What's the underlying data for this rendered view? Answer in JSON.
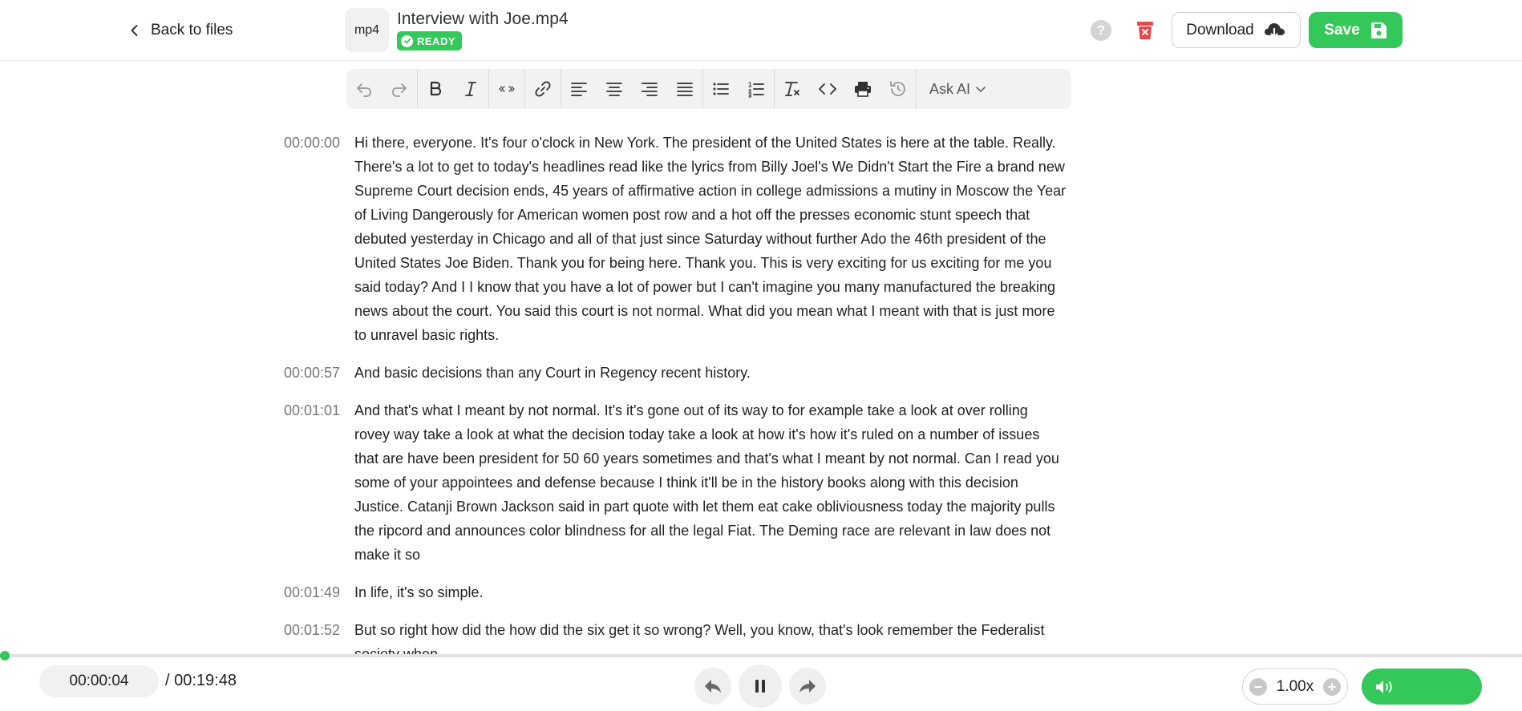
{
  "header": {
    "back_label": "Back to files",
    "file_type": "mp4",
    "file_title": "Interview with Joe.mp4",
    "status": "READY",
    "help_symbol": "?",
    "download_label": "Download",
    "save_label": "Save"
  },
  "toolbar": {
    "ask_ai_label": "Ask AI",
    "buttons": [
      "undo-icon",
      "redo-icon",
      "bold-icon",
      "italic-icon",
      "quote-icon",
      "link-icon",
      "align-left-icon",
      "align-center-icon",
      "align-right-icon",
      "align-justify-icon",
      "bullet-list-icon",
      "numbered-list-icon",
      "clear-format-icon",
      "code-icon",
      "print-icon",
      "history-icon"
    ]
  },
  "transcript": [
    {
      "time": "00:00:00",
      "text": "Hi there, everyone. It's four o'clock in New York. The president of the United States is here at the table. Really. There's a lot to get to today's headlines read like the lyrics from Billy Joel's We Didn't Start the Fire a brand new Supreme Court decision ends, 45 years of affirmative action in college admissions a mutiny in Moscow the Year of Living Dangerously for American women post row and a hot off the presses economic stunt speech that debuted yesterday in Chicago and all of that just since Saturday without further Ado the 46th president of the United States Joe Biden. Thank you for being here. Thank you. This is very exciting for us exciting for me you said today? And I I know that you have a lot of power but I can't imagine you many manufactured the breaking news about the court. You said this court is not normal. What did you mean what I meant with that is just more to unravel basic rights."
    },
    {
      "time": "00:00:57",
      "text": "And basic decisions than any Court in Regency recent history."
    },
    {
      "time": "00:01:01",
      "text": "And that's what I meant by not normal. It's it's gone out of its way to for example take a look at over rolling rovey way take a look at what the decision today take a look at how it's how it's ruled on a number of issues that are have been president for 50 60 years sometimes and that's what I meant by not normal. Can I read you some of your appointees and defense because I think it'll be in the history books along with this decision Justice. Catanji Brown Jackson said in part quote with let them eat cake obliviousness today the majority pulls the ripcord and announces color blindness for all the legal Fiat. The Deming race are relevant in law does not make it so"
    },
    {
      "time": "00:01:49",
      "text": "In life, it's so simple."
    },
    {
      "time": "00:01:52",
      "text": "But so right how did the how did the six get it so wrong? Well, you know, that's look remember the Federalist society when ... "
    }
  ],
  "player": {
    "current_time": "00:00:04",
    "duration": "/ 00:19:48",
    "progress_fraction": 0.0034,
    "speed": "1.00x",
    "speed_minus": "−",
    "speed_plus": "+"
  },
  "colors": {
    "accent": "#34c759",
    "danger": "#e5484d"
  }
}
